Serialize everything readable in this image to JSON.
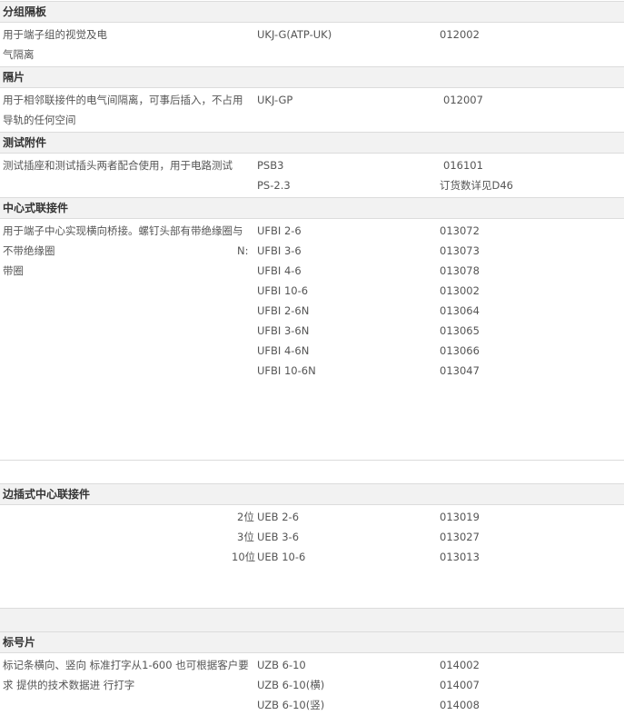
{
  "sections": [
    {
      "title": "分组隔板",
      "desc": [
        "用于端子组的视觉及电",
        "气隔离"
      ],
      "rows": [
        {
          "prefix": "",
          "model": "UKJ-G(ATP-UK)",
          "code": "012002"
        }
      ]
    },
    {
      "title": "隔片",
      "desc": [
        "用于相邻联接件的电气间隔离，可事后插入，不占用",
        "导轨的任何空间"
      ],
      "rows": [
        {
          "prefix": "",
          "model": "UKJ-GP",
          "code": "012007"
        }
      ]
    },
    {
      "title": "测试附件",
      "desc": [
        "测试插座和测试插头两者配合使用，用于电路测试"
      ],
      "rows": [
        {
          "prefix": "",
          "model": "PSB3",
          "code": "016101"
        },
        {
          "prefix": "",
          "model": "PS-2.3",
          "code": "订货数详见D46"
        }
      ]
    },
    {
      "title": "中心式联接件",
      "desc": [
        "用于端子中心实现横向桥接。螺钉头部有带绝缘圈与",
        "不带绝缘圈",
        "带圈"
      ],
      "rows": [
        {
          "prefix": "",
          "model": "UFBI 2-6",
          "code": "013072"
        },
        {
          "prefix": "N:",
          "model": "UFBI 3-6",
          "code": "013073"
        },
        {
          "prefix": "",
          "model": "UFBI 4-6",
          "code": "013078"
        },
        {
          "prefix": "",
          "model": "UFBI 10-6",
          "code": "013002"
        },
        {
          "prefix": "",
          "model": "UFBI 2-6N",
          "code": "013064"
        },
        {
          "prefix": "",
          "model": "UFBI 3-6N",
          "code": "013065"
        },
        {
          "prefix": "",
          "model": "UFBI 4-6N",
          "code": "013066"
        },
        {
          "prefix": "",
          "model": "UFBI 10-6N",
          "code": "013047"
        }
      ]
    },
    {
      "title": "边插式中心联接件",
      "desc": [],
      "rows": [
        {
          "prefix": "2位",
          "model": "UEB 2-6",
          "code": "013019"
        },
        {
          "prefix": "3位",
          "model": "UEB 3-6",
          "code": "013027"
        },
        {
          "prefix": "10位",
          "model": "UEB 10-6",
          "code": "013013"
        }
      ]
    },
    {
      "title": "标号片",
      "desc": [
        "标记条横向、竖向 标准打字从1-600 也可根据客户要",
        "求 提供的技术数据进 行打字"
      ],
      "rows": [
        {
          "prefix": "",
          "model": "UZB 6-10",
          "code": "014002"
        },
        {
          "prefix": "",
          "model": "UZB 6-10(横)",
          "code": "014007"
        },
        {
          "prefix": "",
          "model": "UZB 6-10(竖)",
          "code": "014008"
        }
      ]
    }
  ]
}
